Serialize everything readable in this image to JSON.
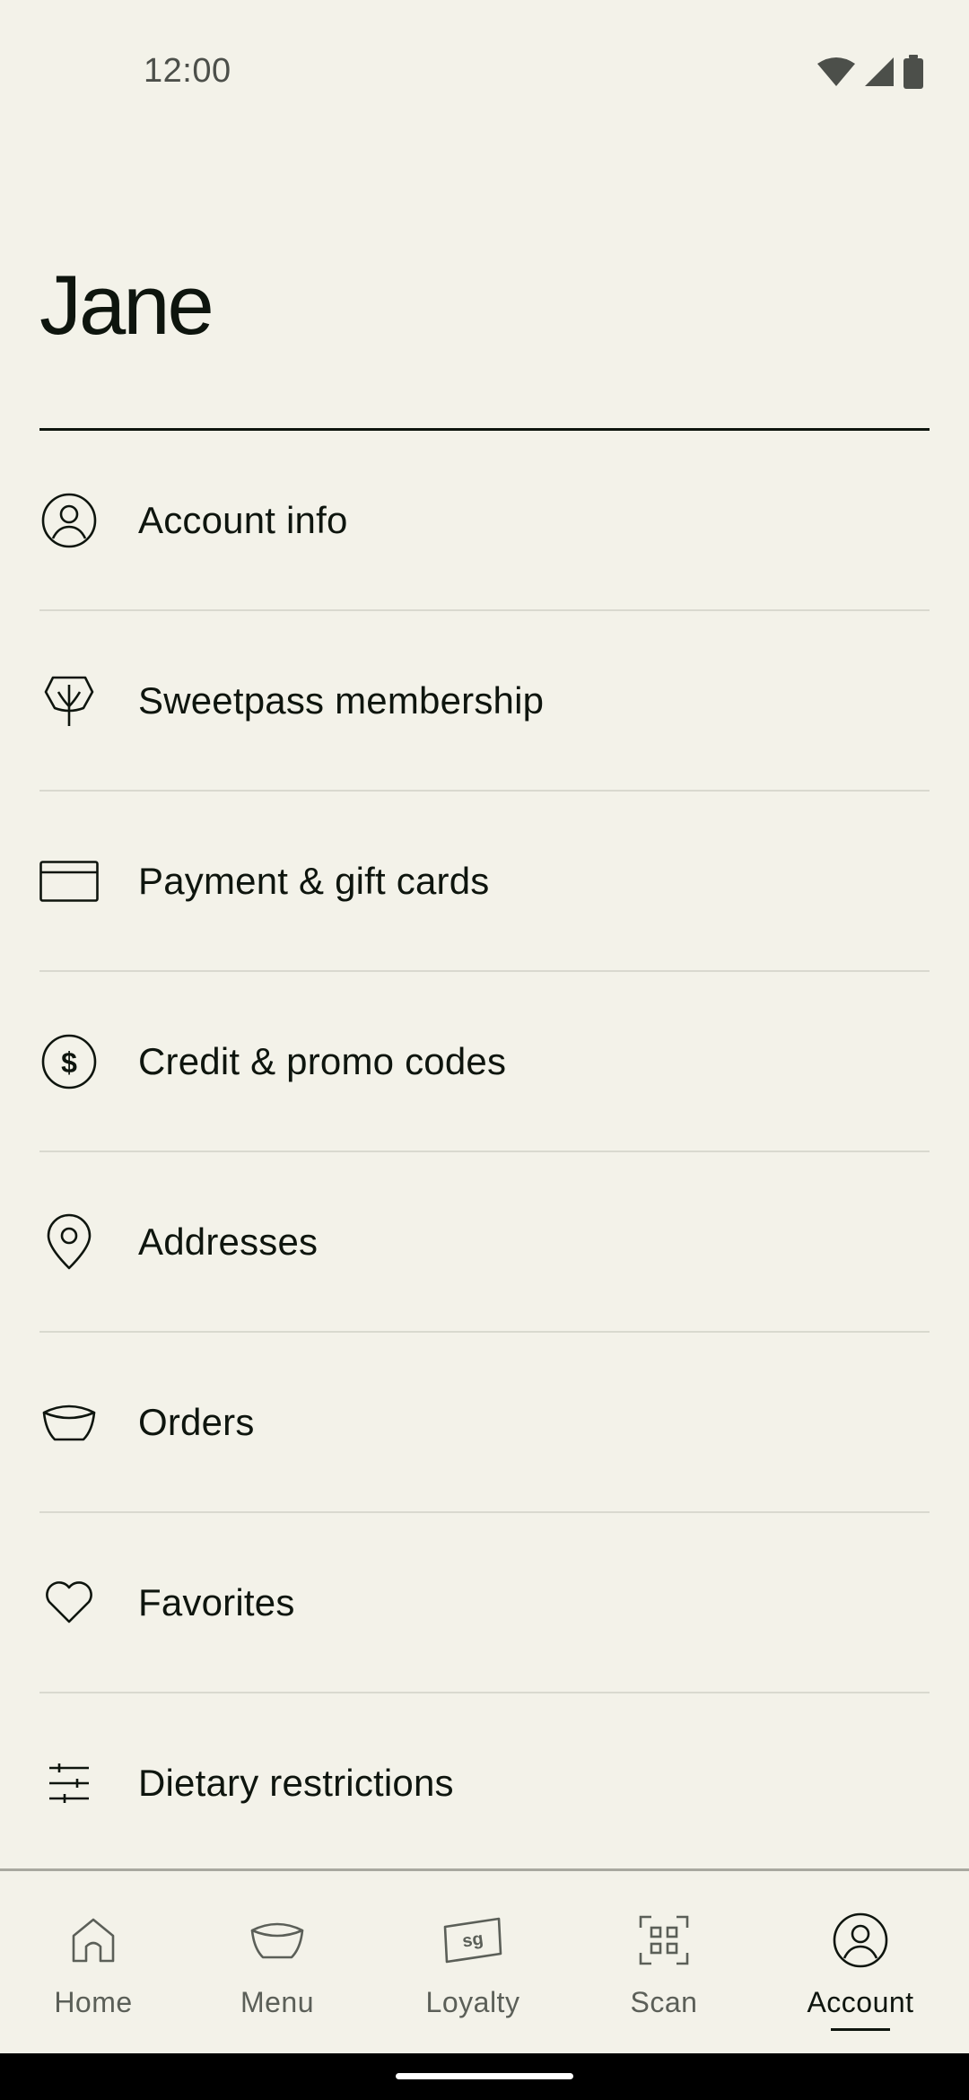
{
  "status_bar": {
    "time": "12:00",
    "icons": [
      "wifi-icon",
      "signal-icon",
      "battery-icon"
    ]
  },
  "profile": {
    "name": "Jane"
  },
  "menu": {
    "items": [
      {
        "label": "Account info",
        "icon": "user-circle-icon"
      },
      {
        "label": "Sweetpass membership",
        "icon": "leaf-icon"
      },
      {
        "label": "Payment & gift cards",
        "icon": "credit-card-icon"
      },
      {
        "label": "Credit & promo codes",
        "icon": "dollar-circle-icon"
      },
      {
        "label": "Addresses",
        "icon": "location-pin-icon"
      },
      {
        "label": "Orders",
        "icon": "bowl-icon"
      },
      {
        "label": "Favorites",
        "icon": "heart-icon"
      },
      {
        "label": "Dietary restrictions",
        "icon": "sliders-icon"
      }
    ]
  },
  "bottom_nav": {
    "items": [
      {
        "label": "Home",
        "icon": "home-icon",
        "active": false
      },
      {
        "label": "Menu",
        "icon": "bowl-icon",
        "active": false
      },
      {
        "label": "Loyalty",
        "icon": "sg-card-icon",
        "active": false
      },
      {
        "label": "Scan",
        "icon": "qr-scan-icon",
        "active": false
      },
      {
        "label": "Account",
        "icon": "user-circle-icon",
        "active": true
      }
    ],
    "loyalty_icon_text": "sg"
  },
  "colors": {
    "background": "#f3f2e9",
    "text": "#0e150e",
    "muted_text": "#5b5f58",
    "divider": "#d9d9cf"
  }
}
